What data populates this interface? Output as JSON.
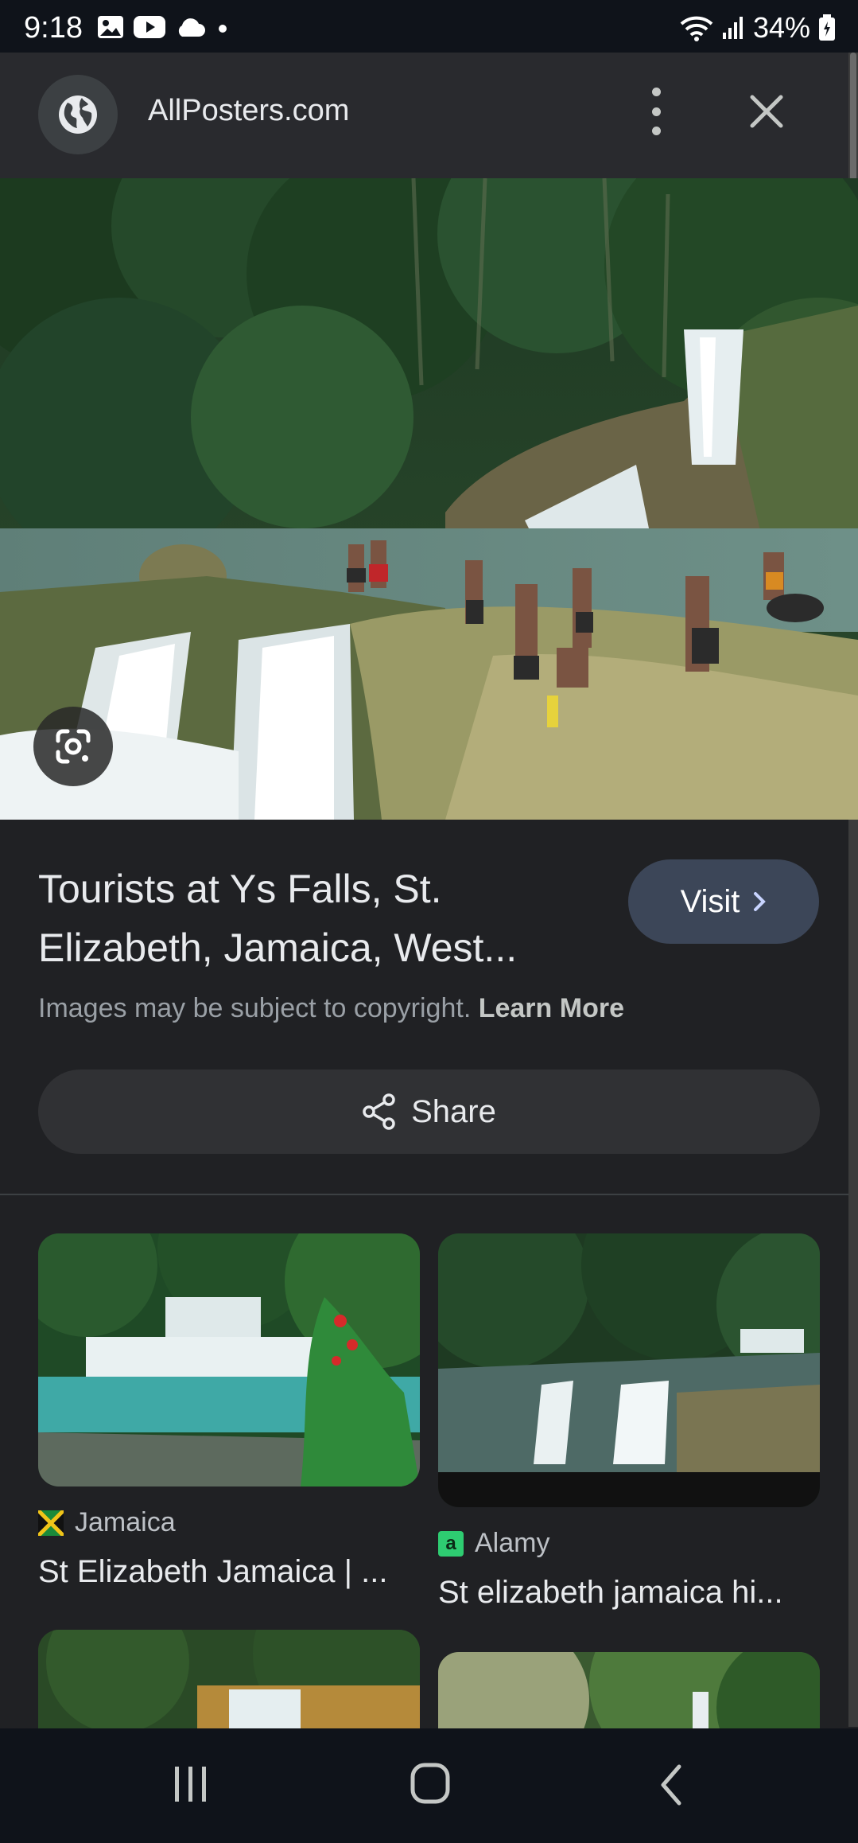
{
  "status_bar": {
    "time": "9:18",
    "battery": "34%",
    "icons": [
      "gallery-icon",
      "youtube-icon",
      "cloud-icon",
      "dot-icon",
      "wifi-icon",
      "signal-icon",
      "battery-icon"
    ]
  },
  "header": {
    "site_name": "AllPosters.com",
    "icons": [
      "globe-icon",
      "more-vert-icon",
      "close-icon"
    ]
  },
  "result": {
    "title": "Tourists at Ys Falls, St. Elizabeth, Jamaica, West...",
    "visit_label": "Visit",
    "copyright_text": "Images may be subject to copyright.",
    "learn_more": "Learn More",
    "share_label": "Share"
  },
  "related": [
    {
      "source": "Jamaica",
      "caption": "St Elizabeth Jamaica | ..."
    },
    {
      "source": "Alamy",
      "caption": "St elizabeth jamaica hi..."
    }
  ],
  "colors": {
    "background": "#202124",
    "topbar": "#292a2e",
    "visit_button": "#3c4658",
    "share_button": "#303134"
  }
}
